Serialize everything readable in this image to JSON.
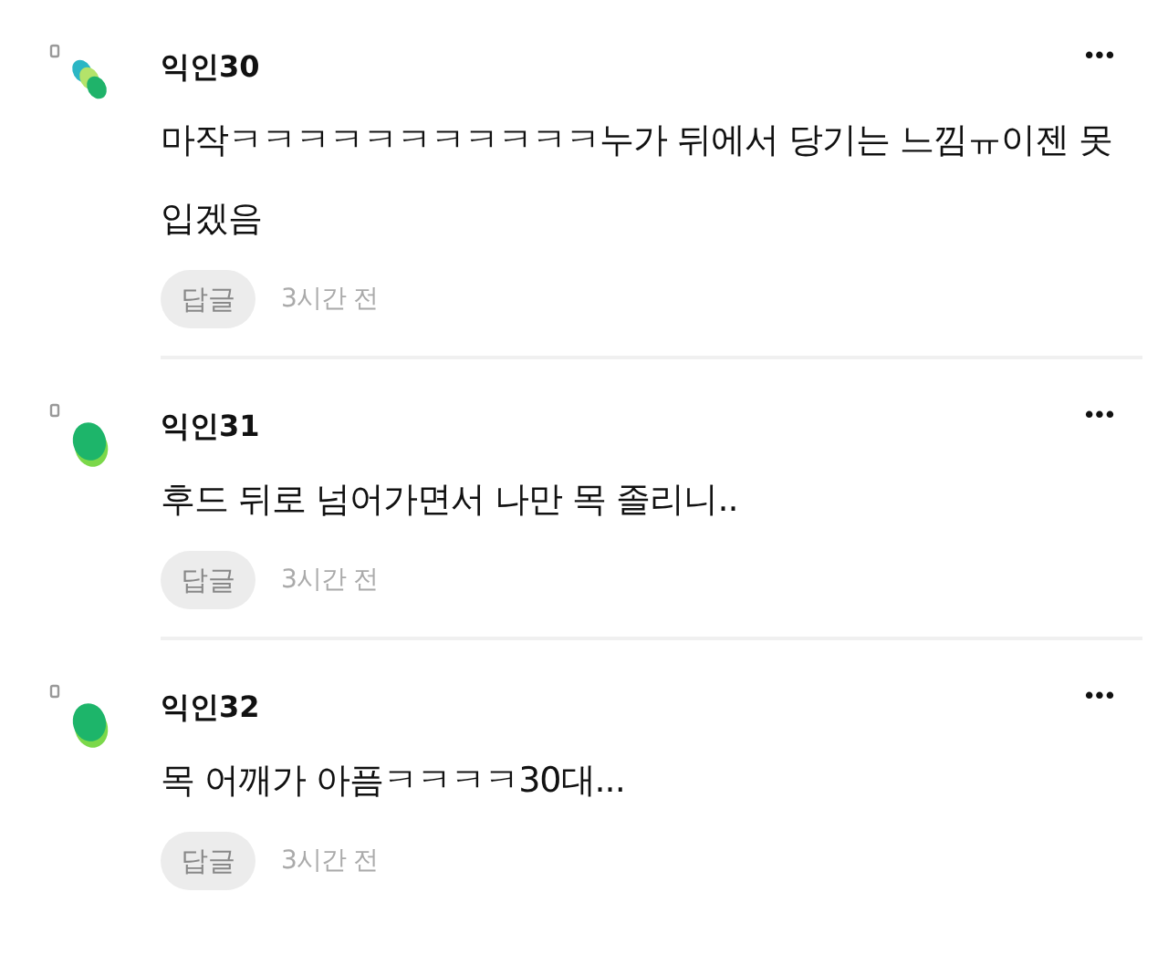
{
  "comments": [
    {
      "author": "익인30",
      "avatar": {
        "kind": "cluster"
      },
      "text": "마작ㅋㅋㅋㅋㅋㅋㅋㅋㅋㅋㅋ누가 뒤에서 당기는 느낌ㅠ이젠 못 입겠음",
      "reply": "답글",
      "time": "3시간 전",
      "more": "•••"
    },
    {
      "author": "익인31",
      "avatar": {
        "kind": "single"
      },
      "text": "후드 뒤로 넘어가면서 나만 목 졸리니..",
      "reply": "답글",
      "time": "3시간 전",
      "more": "•••"
    },
    {
      "author": "익인32",
      "avatar": {
        "kind": "single"
      },
      "text": "목 어깨가 아픔ㅋㅋㅋㅋ30대...",
      "reply": "답글",
      "time": "3시간 전",
      "more": "•••"
    }
  ]
}
